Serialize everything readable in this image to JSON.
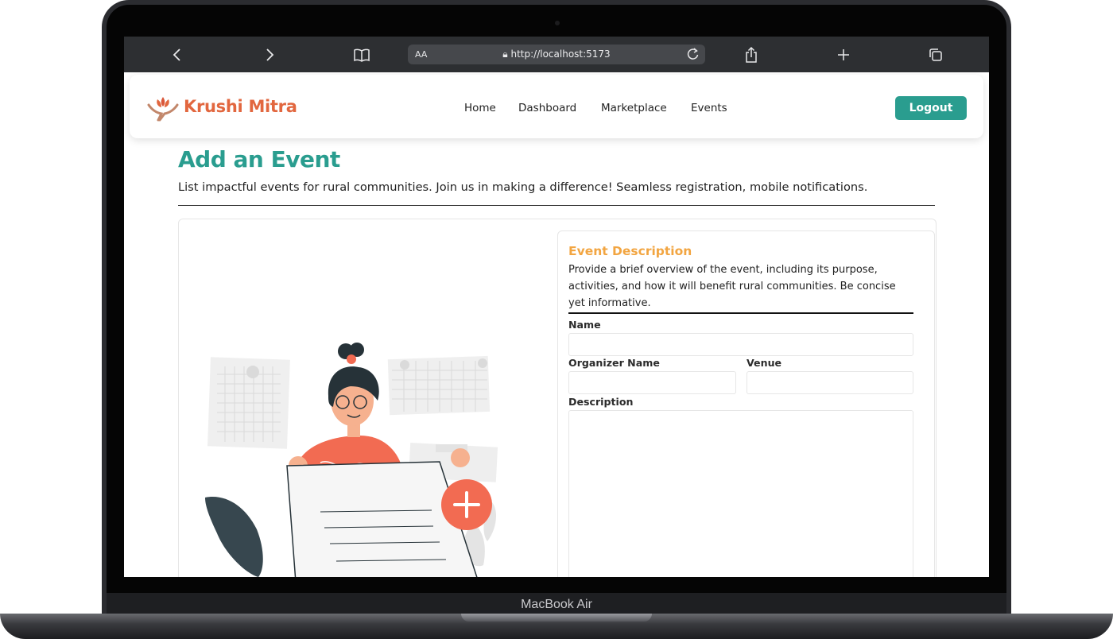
{
  "device": {
    "label": "MacBook Air"
  },
  "browser": {
    "text_size_label": "AA",
    "url": "http://localhost:5173"
  },
  "navbar": {
    "brand": "Krushi Mitra",
    "links": [
      "Home",
      "Dashboard",
      "Marketplace",
      "Events"
    ],
    "logout_label": "Logout"
  },
  "page": {
    "title": "Add an Event",
    "subtitle": "List impactful events for rural communities. Join us in making a difference! Seamless registration, mobile notifications."
  },
  "form": {
    "title": "Event Description",
    "description": "Provide a brief overview of the event, including its purpose, activities, and how it will benefit rural communities. Be concise yet informative.",
    "fields": {
      "name_label": "Name",
      "organizer_label": "Organizer Name",
      "venue_label": "Venue",
      "description_label": "Description"
    }
  },
  "colors": {
    "accent": "#2a9d8f",
    "brand": "#e2673f",
    "form_title": "#f2a541"
  }
}
